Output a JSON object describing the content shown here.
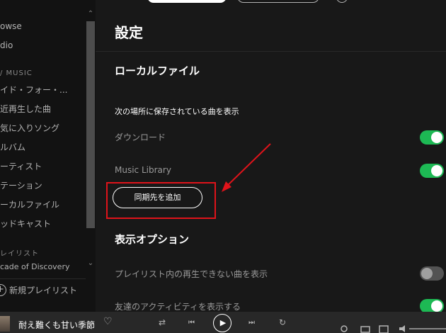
{
  "sidebar": {
    "items_top": [
      "owse",
      "dio"
    ],
    "library_heading": "/ MUSIC",
    "library_items": [
      "イド・フォー・...",
      "近再生した曲",
      "気に入りソング",
      "ルバム",
      "ーティスト",
      "テーション",
      "ーカルファイル",
      "ッドキャスト"
    ],
    "playlists_heading": "レイリスト",
    "playlist_item": "cade of Discovery",
    "new_playlist_label": "新規プレイリスト",
    "scroll_up": "⌃",
    "scroll_down": "⌄"
  },
  "main": {
    "title": "設定",
    "local_files": {
      "title": "ローカルファイル",
      "subheading": "次の場所に保存されている曲を表示",
      "rows": [
        {
          "label": "ダウンロード",
          "on": true
        },
        {
          "label": "Music Library",
          "on": true
        }
      ],
      "add_button": "同期先を追加"
    },
    "display_options": {
      "title": "表示オプション",
      "rows": [
        {
          "label": "プレイリスト内の再生できない曲を表示",
          "on": false
        },
        {
          "label": "友達のアクティビティを表示する",
          "on": true
        }
      ]
    }
  },
  "annotation": {
    "color": "#e0131a"
  },
  "player": {
    "track_title": "耐え難くも甘い季節",
    "heart_icon": "♡",
    "shuffle_icon": "⇄",
    "prev_icon": "⏮",
    "play_icon": "▶",
    "next_icon": "⏭",
    "repeat_icon": "↻"
  },
  "colors": {
    "accent": "#1db954",
    "background": "#181818",
    "sidebar": "#121212"
  }
}
